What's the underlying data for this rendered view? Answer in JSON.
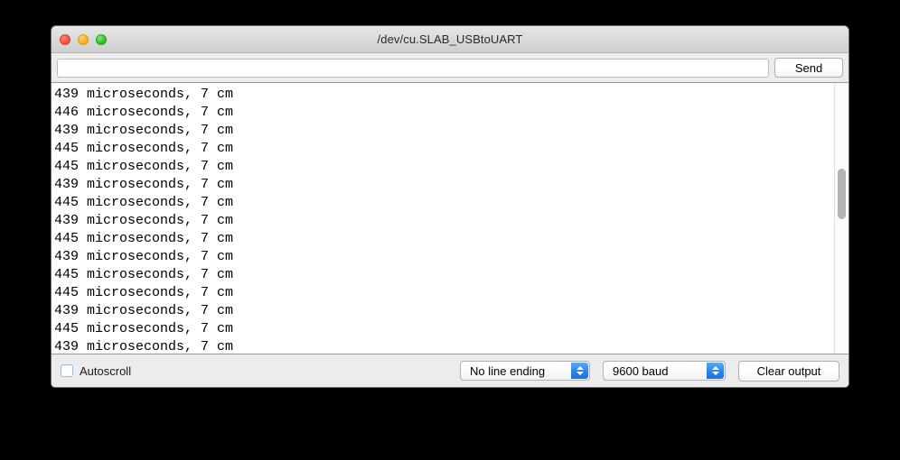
{
  "window": {
    "title": "/dev/cu.SLAB_USBtoUART",
    "traffic_lights": {
      "close": "close-button",
      "minimize": "minimize-button",
      "maximize": "maximize-button"
    }
  },
  "send_row": {
    "input_value": "",
    "input_placeholder": "",
    "send_label": "Send"
  },
  "output": {
    "lines": [
      "439 microseconds, 7 cm",
      "446 microseconds, 7 cm",
      "439 microseconds, 7 cm",
      "445 microseconds, 7 cm",
      "445 microseconds, 7 cm",
      "439 microseconds, 7 cm",
      "445 microseconds, 7 cm",
      "439 microseconds, 7 cm",
      "445 microseconds, 7 cm",
      "439 microseconds, 7 cm",
      "445 microseconds, 7 cm",
      "445 microseconds, 7 cm",
      "439 microseconds, 7 cm",
      "445 microseconds, 7 cm",
      "439 microseconds, 7 cm"
    ]
  },
  "bottom_bar": {
    "autoscroll_label": "Autoscroll",
    "autoscroll_checked": false,
    "line_ending_selected": "No line ending",
    "baud_selected": "9600 baud",
    "clear_label": "Clear output"
  },
  "colors": {
    "accent_blue": "#2f87ee",
    "window_chrome": "#ececec",
    "output_background": "#ffffff",
    "desktop_background": "#000000",
    "close_red": "#f6564a",
    "minimize_amber": "#fdb02a",
    "maximize_green": "#2fc52c"
  }
}
